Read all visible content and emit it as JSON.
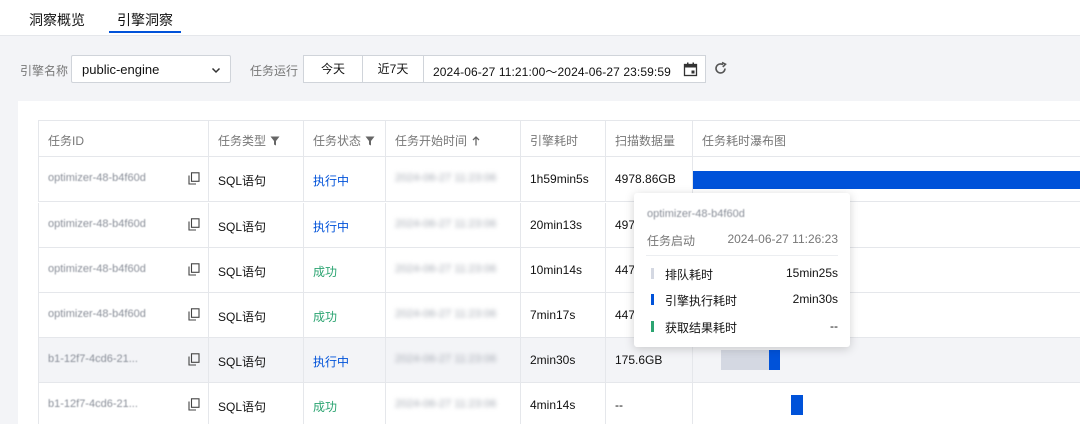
{
  "tabs": [
    {
      "label": "洞察概览"
    },
    {
      "label": "引擎洞察",
      "active": true
    }
  ],
  "filters": {
    "engine_label": "引擎名称",
    "engine_value": "public-engine",
    "task_run_label": "任务运行",
    "today": "今天",
    "last7": "近7天",
    "date_range": "2024-06-27 11:21:00～2024-06-27 23:59:59"
  },
  "table": {
    "headers": [
      "任务ID",
      "任务类型",
      "任务状态",
      "任务开始时间",
      "引擎耗时",
      "扫描数据量",
      "任务耗时瀑布图"
    ],
    "rows": [
      {
        "id": "optimizer-48-b4f60d",
        "type": "SQL语句",
        "status": "执行中",
        "status_kind": "run",
        "start": "2024-06-27 11:23:06",
        "engine_time": "1h59min5s",
        "scan": "4978.86GB"
      },
      {
        "id": "optimizer-48-b4f60d",
        "type": "SQL语句",
        "status": "执行中",
        "status_kind": "run",
        "start": "2024-06-27 11:23:06",
        "engine_time": "20min13s",
        "scan": "497"
      },
      {
        "id": "optimizer-48-b4f60d",
        "type": "SQL语句",
        "status": "成功",
        "status_kind": "ok",
        "start": "2024-06-27 11:23:06",
        "engine_time": "10min14s",
        "scan": "447"
      },
      {
        "id": "optimizer-48-b4f60d",
        "type": "SQL语句",
        "status": "成功",
        "status_kind": "ok",
        "start": "2024-06-27 11:23:06",
        "engine_time": "7min17s",
        "scan": "447"
      },
      {
        "id": "b1-12f7-4cd6-21...",
        "type": "SQL语句",
        "status": "执行中",
        "status_kind": "run",
        "start": "2024-06-27 11:23:06",
        "engine_time": "2min30s",
        "scan": "175.6GB"
      },
      {
        "id": "b1-12f7-4cd6-21...",
        "type": "SQL语句",
        "status": "成功",
        "status_kind": "ok",
        "start": "2024-06-27 11:23:06",
        "engine_time": "4min14s",
        "scan": "--"
      }
    ]
  },
  "tooltip": {
    "id": "optimizer-48-b4f60d",
    "start_label": "任务启动",
    "start_value": "2024-06-27 11:26:23",
    "queue_label": "排队耗时",
    "queue_value": "15min25s",
    "exec_label": "引擎执行耗时",
    "exec_value": "2min30s",
    "fetch_label": "获取结果耗时",
    "fetch_value": "--"
  },
  "colors": {
    "accent": "#0052d9",
    "running": "#0052d9",
    "success": "#2ba471",
    "queue": "#d4d8e2",
    "fetch": "#2ba471"
  }
}
